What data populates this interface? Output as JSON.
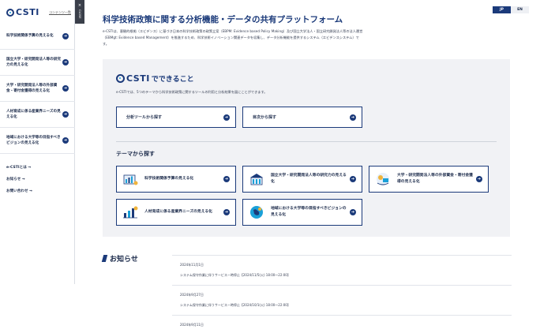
{
  "sidebar": {
    "logo_text": "CSTI",
    "logo_sub": "コンテンツ一覧",
    "close_x": "×",
    "close_label": "CLOSE",
    "items": [
      {
        "label": "科学技術関係予算の見える化"
      },
      {
        "label": "国立大学・研究開発法人等の研究力の見える化"
      },
      {
        "label": "大学・研究開発法人等の外部資金・寄付金獲得の見える化"
      },
      {
        "label": "人材育成に係る産業界ニーズの見える化"
      },
      {
        "label": "地域における大学等の目指すべきビジョンの見える化"
      }
    ],
    "links": [
      {
        "label": "e-CSTIとは →"
      },
      {
        "label": "お知らせ →"
      },
      {
        "label": "お問い合わせ →"
      }
    ]
  },
  "lang": {
    "jp": "JP",
    "en": "EN"
  },
  "header": {
    "title": "科学技術政策に関する分析機能・データの共有プラットフォーム",
    "intro": "e-CSTIは、客観的根拠（エビデンス）に基づき日本の科学技術政策の政策立案（EBPM: Evidence based Policy Making）及び国立大学法人・国立研究開発法人等の法人運営（EBMgt: Evidence based Management）を推進するため、科学技術イノベーション関連データを収集し、データ分析機能を提供するシステム（エビデンスシステム）です。"
  },
  "panel": {
    "logo_text": "CSTI",
    "heading_suffix": "でできること",
    "desc": "e-CSTIでは、5つのテーマから科学技術政策に関するツールの利用と分析結果を図にことができます。",
    "buttons": [
      {
        "label": "分析ツールから探す"
      },
      {
        "label": "目次から探す"
      }
    ],
    "theme_heading": "テーマから探す",
    "cards": [
      {
        "label": "科学技術関係予算の見える化"
      },
      {
        "label": "国立大学・研究開発法人等の研究力の見える化"
      },
      {
        "label": "大学・研究開発法人等の外部資金・寄付金獲得の見える化"
      },
      {
        "label": "人材育成に係る産業界ニーズの見える化"
      },
      {
        "label": "地域における大学等の目指すべきビジョンの見える化"
      }
    ]
  },
  "news": {
    "heading": "お知らせ",
    "items": [
      {
        "date": "2024年11月1日",
        "text": "システム保守作業に伴うサービス一時停止【2024/11/5(火) 18:00〜22:00】"
      },
      {
        "date": "2024年9月27日",
        "text": "システム保守作業に伴うサービス一時停止【2024/10/1(火) 18:00〜22:00】"
      },
      {
        "date": "2024年9月11日",
        "text": ""
      }
    ]
  },
  "colors": {
    "brand": "#1b3a7a",
    "accent": "#1aa0d8",
    "panel_bg": "#f1f2f5"
  }
}
